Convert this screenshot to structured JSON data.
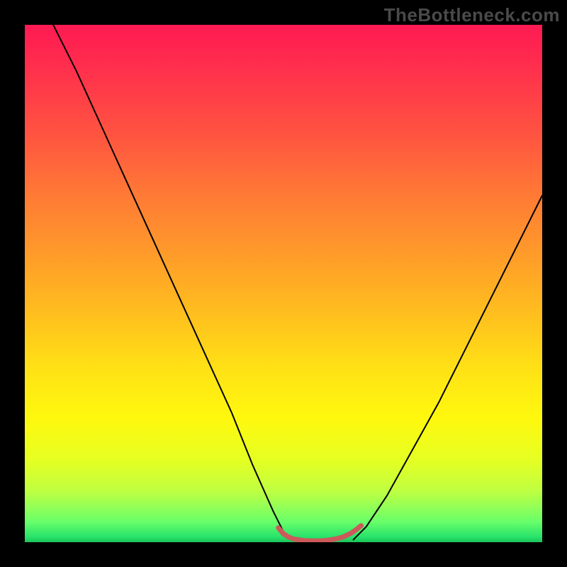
{
  "watermark": "TheBottleneck.com",
  "chart_data": {
    "type": "line",
    "title": "",
    "xlabel": "",
    "ylabel": "",
    "xlim": [
      0,
      100
    ],
    "ylim": [
      0,
      100
    ],
    "grid": false,
    "series": [
      {
        "name": "left-curve",
        "stroke": "#000000",
        "x": [
          5.5,
          10,
          15,
          20,
          25,
          30,
          35,
          40,
          44,
          48,
          50,
          51.5
        ],
        "y_top": [
          100,
          91,
          80,
          69,
          58,
          47,
          36,
          25,
          15,
          6,
          2,
          0.5
        ]
      },
      {
        "name": "right-curve",
        "stroke": "#000000",
        "x": [
          63.5,
          66,
          70,
          75,
          80,
          85,
          90,
          95,
          100
        ],
        "y_top": [
          0.5,
          3,
          9,
          18,
          27,
          37,
          47,
          57,
          67
        ]
      },
      {
        "name": "bottom-arc",
        "stroke": "#CC5A5A",
        "x": [
          49,
          50,
          51,
          52,
          54,
          56,
          58,
          60,
          61.5,
          63,
          64,
          65
        ],
        "y_top": [
          2.8,
          1.6,
          1.0,
          0.6,
          0.3,
          0.25,
          0.3,
          0.6,
          1.0,
          1.7,
          2.4,
          3.2
        ]
      }
    ],
    "background_gradient_stops": [
      {
        "pos": 0.0,
        "color": "#ff1a53"
      },
      {
        "pos": 0.22,
        "color": "#ff5640"
      },
      {
        "pos": 0.44,
        "color": "#ff9a2a"
      },
      {
        "pos": 0.66,
        "color": "#ffe016"
      },
      {
        "pos": 0.84,
        "color": "#e6ff22"
      },
      {
        "pos": 0.96,
        "color": "#6aff6a"
      },
      {
        "pos": 1.0,
        "color": "#1dc45a"
      }
    ]
  }
}
